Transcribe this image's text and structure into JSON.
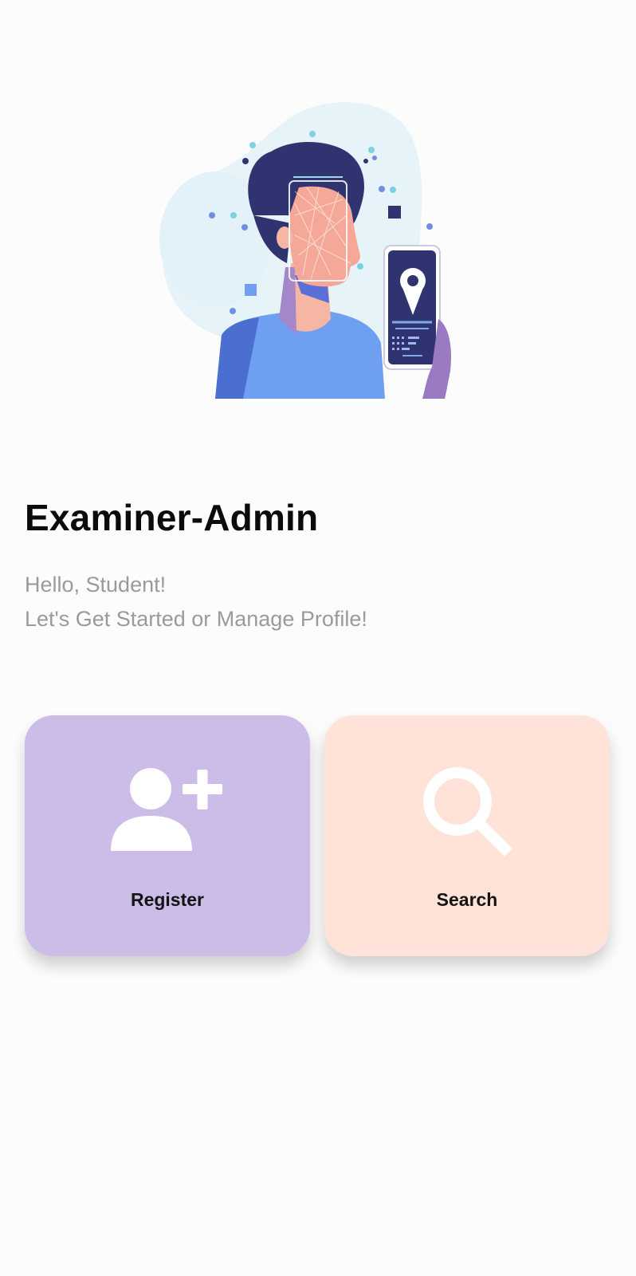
{
  "header": {
    "title": "Examiner-Admin",
    "greeting": "Hello, Student!",
    "prompt": "Let's Get Started or Manage Profile!"
  },
  "actions": [
    {
      "label": "Register",
      "icon": "add-user-icon",
      "color": "#cbbce8"
    },
    {
      "label": "Search",
      "icon": "search-icon",
      "color": "#ffe3d8"
    }
  ],
  "illustration": {
    "icon": "face-recognition-illustration"
  },
  "colors": {
    "background": "#fcfcfd",
    "title": "#0b0b0b",
    "subtitle": "#9a9a9a",
    "accent_navy": "#2f3470",
    "accent_blue": "#6f9ff0"
  }
}
